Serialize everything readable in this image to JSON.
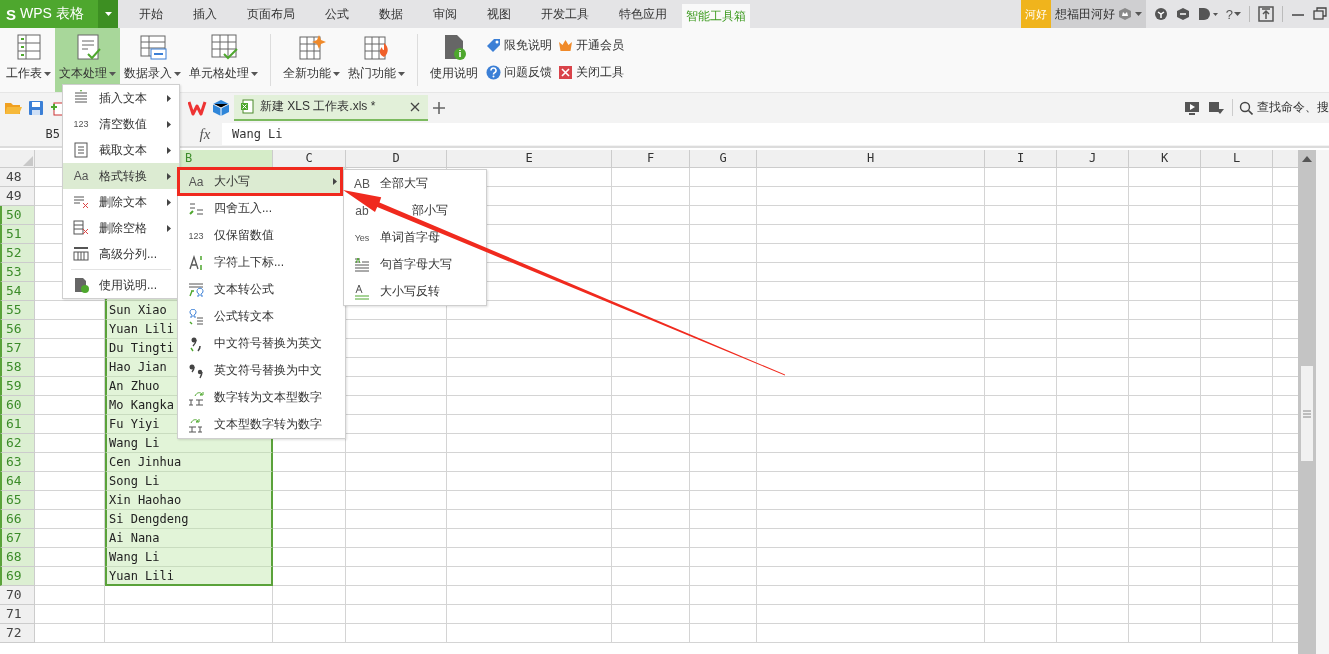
{
  "title_bar": {
    "logo_mark": "S",
    "app_name": "WPS 表格",
    "tabs": [
      {
        "label": "开始",
        "selected": false
      },
      {
        "label": "插入",
        "selected": false
      },
      {
        "label": "页面布局",
        "selected": false
      },
      {
        "label": "公式",
        "selected": false
      },
      {
        "label": "数据",
        "selected": false
      },
      {
        "label": "审阅",
        "selected": false
      },
      {
        "label": "视图",
        "selected": false
      },
      {
        "label": "开发工具",
        "selected": false
      },
      {
        "label": "特色应用",
        "selected": false
      },
      {
        "label": "智能工具箱",
        "selected": true
      }
    ],
    "account_badge": "河好",
    "user_name": "想福田河好",
    "help": "?"
  },
  "ribbon": {
    "buttons": [
      {
        "label": "工作表",
        "dropdown": true,
        "selected": false
      },
      {
        "label": "文本处理",
        "dropdown": true,
        "selected": true
      },
      {
        "label": "数据录入",
        "dropdown": true,
        "selected": false
      },
      {
        "label": "单元格处理",
        "dropdown": true,
        "selected": false
      },
      {
        "label": "全新功能",
        "dropdown": true,
        "selected": false
      },
      {
        "label": "热门功能",
        "dropdown": true,
        "selected": false
      },
      {
        "label": "使用说明",
        "dropdown": false,
        "selected": false
      }
    ],
    "links": [
      {
        "label": "限免说明"
      },
      {
        "label": "问题反馈"
      },
      {
        "label": "开通会员"
      },
      {
        "label": "关闭工具"
      }
    ]
  },
  "document_tabs": [
    {
      "label": "新建 XLS 工作表.xls *",
      "selected": true
    }
  ],
  "search": {
    "placeholder": "查找命令、搜"
  },
  "formula_bar": {
    "cell": "B5",
    "fx": "fx",
    "value": "Wang Li"
  },
  "sheet": {
    "columns": [
      {
        "selected": false
      },
      {
        "label": "B",
        "selected": true
      },
      {
        "label": "C",
        "selected": false
      },
      {
        "label": "D",
        "selected": false
      },
      {
        "label": "E",
        "selected": false
      },
      {
        "label": "F",
        "selected": false
      },
      {
        "label": "G",
        "selected": false
      },
      {
        "label": "H",
        "selected": false
      },
      {
        "label": "I",
        "selected": false
      },
      {
        "label": "J",
        "selected": false
      },
      {
        "label": "K",
        "selected": false
      },
      {
        "label": "L",
        "selected": false
      }
    ],
    "rows": [
      {
        "number": "48",
        "selected": false
      },
      {
        "number": "49",
        "selected": false
      },
      {
        "number": "50",
        "selected": true
      },
      {
        "number": "51",
        "selected": true
      },
      {
        "number": "52",
        "selected": true
      },
      {
        "number": "53",
        "selected": true
      },
      {
        "number": "54",
        "selected": true
      },
      {
        "number": "55",
        "selected": true,
        "b": "Sun Xiao"
      },
      {
        "number": "56",
        "selected": true,
        "b": "Yuan Lili"
      },
      {
        "number": "57",
        "selected": true,
        "b": "Du Tingti"
      },
      {
        "number": "58",
        "selected": true,
        "b": "Hao Jian"
      },
      {
        "number": "59",
        "selected": true,
        "b": "An Zhuo"
      },
      {
        "number": "60",
        "selected": true,
        "b": "Mo Kangka"
      },
      {
        "number": "61",
        "selected": true,
        "b": "Fu Yiyi"
      },
      {
        "number": "62",
        "selected": true,
        "b": "Wang Li"
      },
      {
        "number": "63",
        "selected": true,
        "b": "Cen Jinhua"
      },
      {
        "number": "64",
        "selected": true,
        "b": "Song Li"
      },
      {
        "number": "65",
        "selected": true,
        "b": "Xin Haohao"
      },
      {
        "number": "66",
        "selected": true,
        "b": "Si Dengdeng"
      },
      {
        "number": "67",
        "selected": true,
        "b": "Ai Nana"
      },
      {
        "number": "68",
        "selected": true,
        "b": "Wang Li"
      },
      {
        "number": "69",
        "selected": true,
        "b": "Yuan Lili"
      },
      {
        "number": "70",
        "selected": false
      },
      {
        "number": "71",
        "selected": false
      },
      {
        "number": "72",
        "selected": false
      }
    ]
  },
  "menus": [
    {
      "items": [
        {
          "label": "插入文本",
          "submenu": true,
          "selected": false
        },
        {
          "label": "清空数值",
          "submenu": true,
          "selected": false,
          "glyph": "123"
        },
        {
          "label": "截取文本",
          "submenu": true,
          "selected": false
        },
        {
          "label": "格式转换",
          "submenu": true,
          "selected": true,
          "glyph": "Aa"
        },
        {
          "label": "删除文本",
          "submenu": true,
          "selected": false
        },
        {
          "label": "删除空格",
          "submenu": true,
          "selected": false
        },
        {
          "label": "高级分列...",
          "submenu": false,
          "selected": false
        },
        {
          "label": "使用说明...",
          "submenu": false,
          "selected": false,
          "separator_before": true
        }
      ]
    },
    {
      "items": [
        {
          "label": "大小写",
          "submenu": true,
          "selected": true,
          "glyph": "Aa"
        },
        {
          "label": "四舍五入...",
          "submenu": false,
          "selected": false
        },
        {
          "label": "仅保留数值",
          "submenu": false,
          "selected": false,
          "glyph": "123"
        },
        {
          "label": "字符上下标...",
          "submenu": false,
          "selected": false
        },
        {
          "label": "文本转公式",
          "submenu": false,
          "selected": false
        },
        {
          "label": "公式转文本",
          "submenu": false,
          "selected": false
        },
        {
          "label": "中文符号替换为英文",
          "submenu": false,
          "selected": false
        },
        {
          "label": "英文符号替换为中文",
          "submenu": false,
          "selected": false
        },
        {
          "label": "数字转为文本型数字",
          "submenu": false,
          "selected": false
        },
        {
          "label": "文本型数字转为数字",
          "submenu": false,
          "selected": false
        }
      ]
    },
    {
      "items": [
        {
          "label": "全部大写",
          "submenu": false,
          "selected": false,
          "glyph": "AB"
        },
        {
          "label": "部小写",
          "submenu": false,
          "selected": false,
          "glyph": "ab",
          "covered_start": true
        },
        {
          "label": "单词首字母",
          "submenu": false,
          "selected": false,
          "glyph": "Yes"
        },
        {
          "label": "句首字母大写",
          "submenu": false,
          "selected": false
        },
        {
          "label": "大小写反转",
          "submenu": false,
          "selected": false
        }
      ]
    }
  ]
}
